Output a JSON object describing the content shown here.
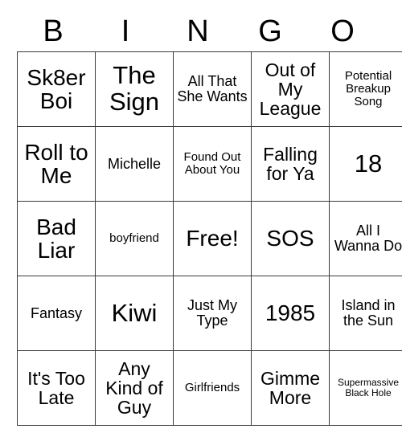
{
  "header": {
    "letters": [
      "B",
      "I",
      "N",
      "G",
      "O"
    ]
  },
  "grid": {
    "rows": [
      [
        {
          "text": "Sk8er Boi",
          "size": "fs-lg"
        },
        {
          "text": "The Sign",
          "size": "fs-xl"
        },
        {
          "text": "All That She Wants",
          "size": "fs-sm"
        },
        {
          "text": "Out of My League",
          "size": "fs-md"
        },
        {
          "text": "Potential Breakup Song",
          "size": "fs-xs"
        }
      ],
      [
        {
          "text": "Roll to Me",
          "size": "fs-lg"
        },
        {
          "text": "Michelle",
          "size": "fs-sm"
        },
        {
          "text": "Found Out About You",
          "size": "fs-xs"
        },
        {
          "text": "Falling for Ya",
          "size": "fs-md"
        },
        {
          "text": "18",
          "size": "fs-xl"
        }
      ],
      [
        {
          "text": "Bad Liar",
          "size": "fs-lg"
        },
        {
          "text": "boyfriend",
          "size": "fs-xs"
        },
        {
          "text": "Free!",
          "size": "fs-lg"
        },
        {
          "text": "SOS",
          "size": "fs-lg"
        },
        {
          "text": "All I Wanna Do",
          "size": "fs-sm"
        }
      ],
      [
        {
          "text": "Fantasy",
          "size": "fs-sm"
        },
        {
          "text": "Kiwi",
          "size": "fs-xl"
        },
        {
          "text": "Just My Type",
          "size": "fs-sm"
        },
        {
          "text": "1985",
          "size": "fs-lg"
        },
        {
          "text": "Island in the Sun",
          "size": "fs-sm"
        }
      ],
      [
        {
          "text": "It's Too Late",
          "size": "fs-md"
        },
        {
          "text": "Any Kind of Guy",
          "size": "fs-md"
        },
        {
          "text": "Girlfriends",
          "size": "fs-xs"
        },
        {
          "text": "Gimme More",
          "size": "fs-md"
        },
        {
          "text": "Supermassive Black Hole",
          "size": "fs-xxs"
        }
      ]
    ]
  },
  "colors": {
    "background": "#ffffff",
    "text": "#000000",
    "border": "#3a3a3a"
  }
}
